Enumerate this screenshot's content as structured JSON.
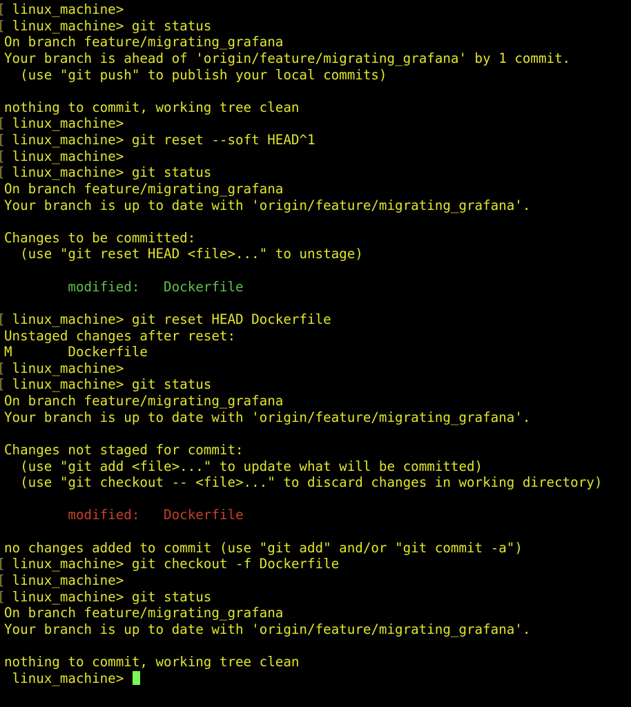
{
  "colors": {
    "text": "#e3e62c",
    "staged": "#5fc24a",
    "unstaged": "#c8402a",
    "cursor": "#7cf55a"
  },
  "prompt": " linux_machine> ",
  "lines": [
    {
      "bracket": true,
      "prompt": true,
      "text": ""
    },
    {
      "bracket": true,
      "prompt": true,
      "text": "git status"
    },
    {
      "text": "On branch feature/migrating_grafana"
    },
    {
      "text": "Your branch is ahead of 'origin/feature/migrating_grafana' by 1 commit."
    },
    {
      "text": "  (use \"git push\" to publish your local commits)"
    },
    {
      "text": ""
    },
    {
      "text": "nothing to commit, working tree clean"
    },
    {
      "bracket": true,
      "prompt": true,
      "text": ""
    },
    {
      "bracket": true,
      "prompt": true,
      "text": "git reset --soft HEAD^1"
    },
    {
      "bracket": true,
      "prompt": true,
      "text": ""
    },
    {
      "bracket": true,
      "prompt": true,
      "text": "git status"
    },
    {
      "text": "On branch feature/migrating_grafana"
    },
    {
      "text": "Your branch is up to date with 'origin/feature/migrating_grafana'."
    },
    {
      "text": ""
    },
    {
      "text": "Changes to be committed:"
    },
    {
      "text": "  (use \"git reset HEAD <file>...\" to unstage)"
    },
    {
      "text": ""
    },
    {
      "text": "        modified:   Dockerfile",
      "style": "green"
    },
    {
      "text": ""
    },
    {
      "bracket": true,
      "prompt": true,
      "text": "git reset HEAD Dockerfile"
    },
    {
      "text": "Unstaged changes after reset:"
    },
    {
      "text": "M       Dockerfile"
    },
    {
      "bracket": true,
      "prompt": true,
      "text": ""
    },
    {
      "bracket": true,
      "prompt": true,
      "text": "git status"
    },
    {
      "text": "On branch feature/migrating_grafana"
    },
    {
      "text": "Your branch is up to date with 'origin/feature/migrating_grafana'."
    },
    {
      "text": ""
    },
    {
      "text": "Changes not staged for commit:"
    },
    {
      "text": "  (use \"git add <file>...\" to update what will be committed)"
    },
    {
      "text": "  (use \"git checkout -- <file>...\" to discard changes in working directory)"
    },
    {
      "text": ""
    },
    {
      "text": "        modified:   Dockerfile",
      "style": "red"
    },
    {
      "text": ""
    },
    {
      "text": "no changes added to commit (use \"git add\" and/or \"git commit -a\")"
    },
    {
      "bracket": true,
      "prompt": true,
      "text": "git checkout -f Dockerfile"
    },
    {
      "bracket": true,
      "prompt": true,
      "text": ""
    },
    {
      "bracket": true,
      "prompt": true,
      "text": "git status"
    },
    {
      "text": "On branch feature/migrating_grafana"
    },
    {
      "text": "Your branch is up to date with 'origin/feature/migrating_grafana'."
    },
    {
      "text": ""
    },
    {
      "text": "nothing to commit, working tree clean"
    },
    {
      "prompt": true,
      "text": "",
      "cursor": true
    }
  ]
}
